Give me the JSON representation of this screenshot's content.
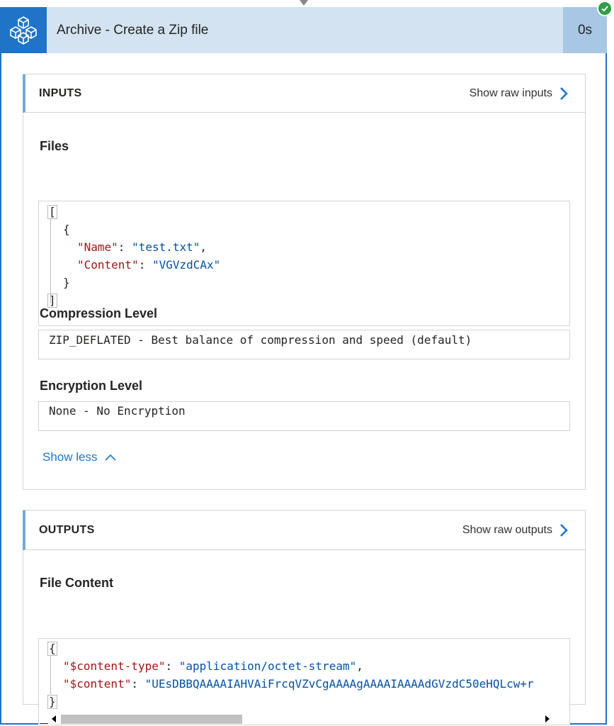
{
  "header": {
    "title": "Archive - Create a Zip file",
    "duration": "0s",
    "icon": "archive-cubes-icon",
    "status_icon": "checkmark-icon",
    "accent_color": "#1f74c8",
    "status_color": "#2f9e44"
  },
  "inputs": {
    "title": "INPUTS",
    "raw_link_label": "Show raw inputs",
    "files_label": "Files",
    "files_json": {
      "open_bracket": "[",
      "open_brace": "{",
      "name_key": "\"Name\"",
      "name_value": "\"test.txt\"",
      "content_key": "\"Content\"",
      "content_value": "\"VGVzdCAx\"",
      "close_brace": "}",
      "close_bracket": "]"
    },
    "compression_label": "Compression Level",
    "compression_value": "ZIP_DEFLATED - Best balance of compression and speed (default)",
    "encryption_label": "Encryption Level",
    "encryption_value": "None - No Encryption",
    "show_less_label": "Show less"
  },
  "outputs": {
    "title": "OUTPUTS",
    "raw_link_label": "Show raw outputs",
    "file_content_label": "File Content",
    "file_content_json": {
      "open_brace": "{",
      "type_key": "\"$content-type\"",
      "type_value": "\"application/octet-stream\"",
      "content_key": "\"$content\"",
      "content_value": "\"UEsDBBQAAAAIAHVAiFrcqVZvCgAAAAgAAAAIAAAAdGVzdC50eHQLcw+r",
      "close_brace": "}"
    }
  }
}
